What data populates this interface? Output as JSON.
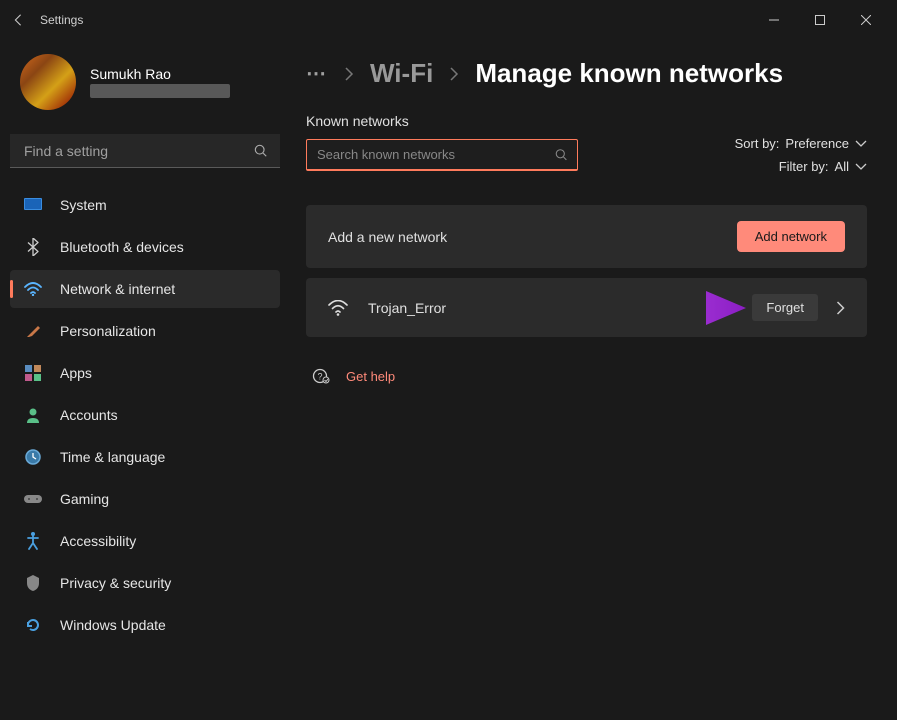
{
  "window": {
    "title": "Settings"
  },
  "profile": {
    "name": "Sumukh Rao"
  },
  "sidebar_search": {
    "placeholder": "Find a setting"
  },
  "nav": [
    {
      "label": "System",
      "icon": "system"
    },
    {
      "label": "Bluetooth & devices",
      "icon": "bluetooth"
    },
    {
      "label": "Network & internet",
      "icon": "network",
      "active": true
    },
    {
      "label": "Personalization",
      "icon": "personalization"
    },
    {
      "label": "Apps",
      "icon": "apps"
    },
    {
      "label": "Accounts",
      "icon": "accounts"
    },
    {
      "label": "Time & language",
      "icon": "time"
    },
    {
      "label": "Gaming",
      "icon": "gaming"
    },
    {
      "label": "Accessibility",
      "icon": "accessibility"
    },
    {
      "label": "Privacy & security",
      "icon": "privacy"
    },
    {
      "label": "Windows Update",
      "icon": "update"
    }
  ],
  "breadcrumb": {
    "parent": "Wi-Fi",
    "current": "Manage known networks"
  },
  "known_networks": {
    "section_title": "Known networks",
    "sort_label": "Sort by:",
    "sort_value": "Preference",
    "filter_label": "Filter by:",
    "filter_value": "All",
    "search_placeholder": "Search known networks",
    "add_panel_text": "Add a new network",
    "add_btn": "Add network",
    "networks": [
      {
        "ssid": "Trojan_Error",
        "forget_btn": "Forget"
      }
    ]
  },
  "help_link": "Get help",
  "colors": {
    "accent": "#ff8a7a",
    "annotation": "#9b2fc7"
  }
}
